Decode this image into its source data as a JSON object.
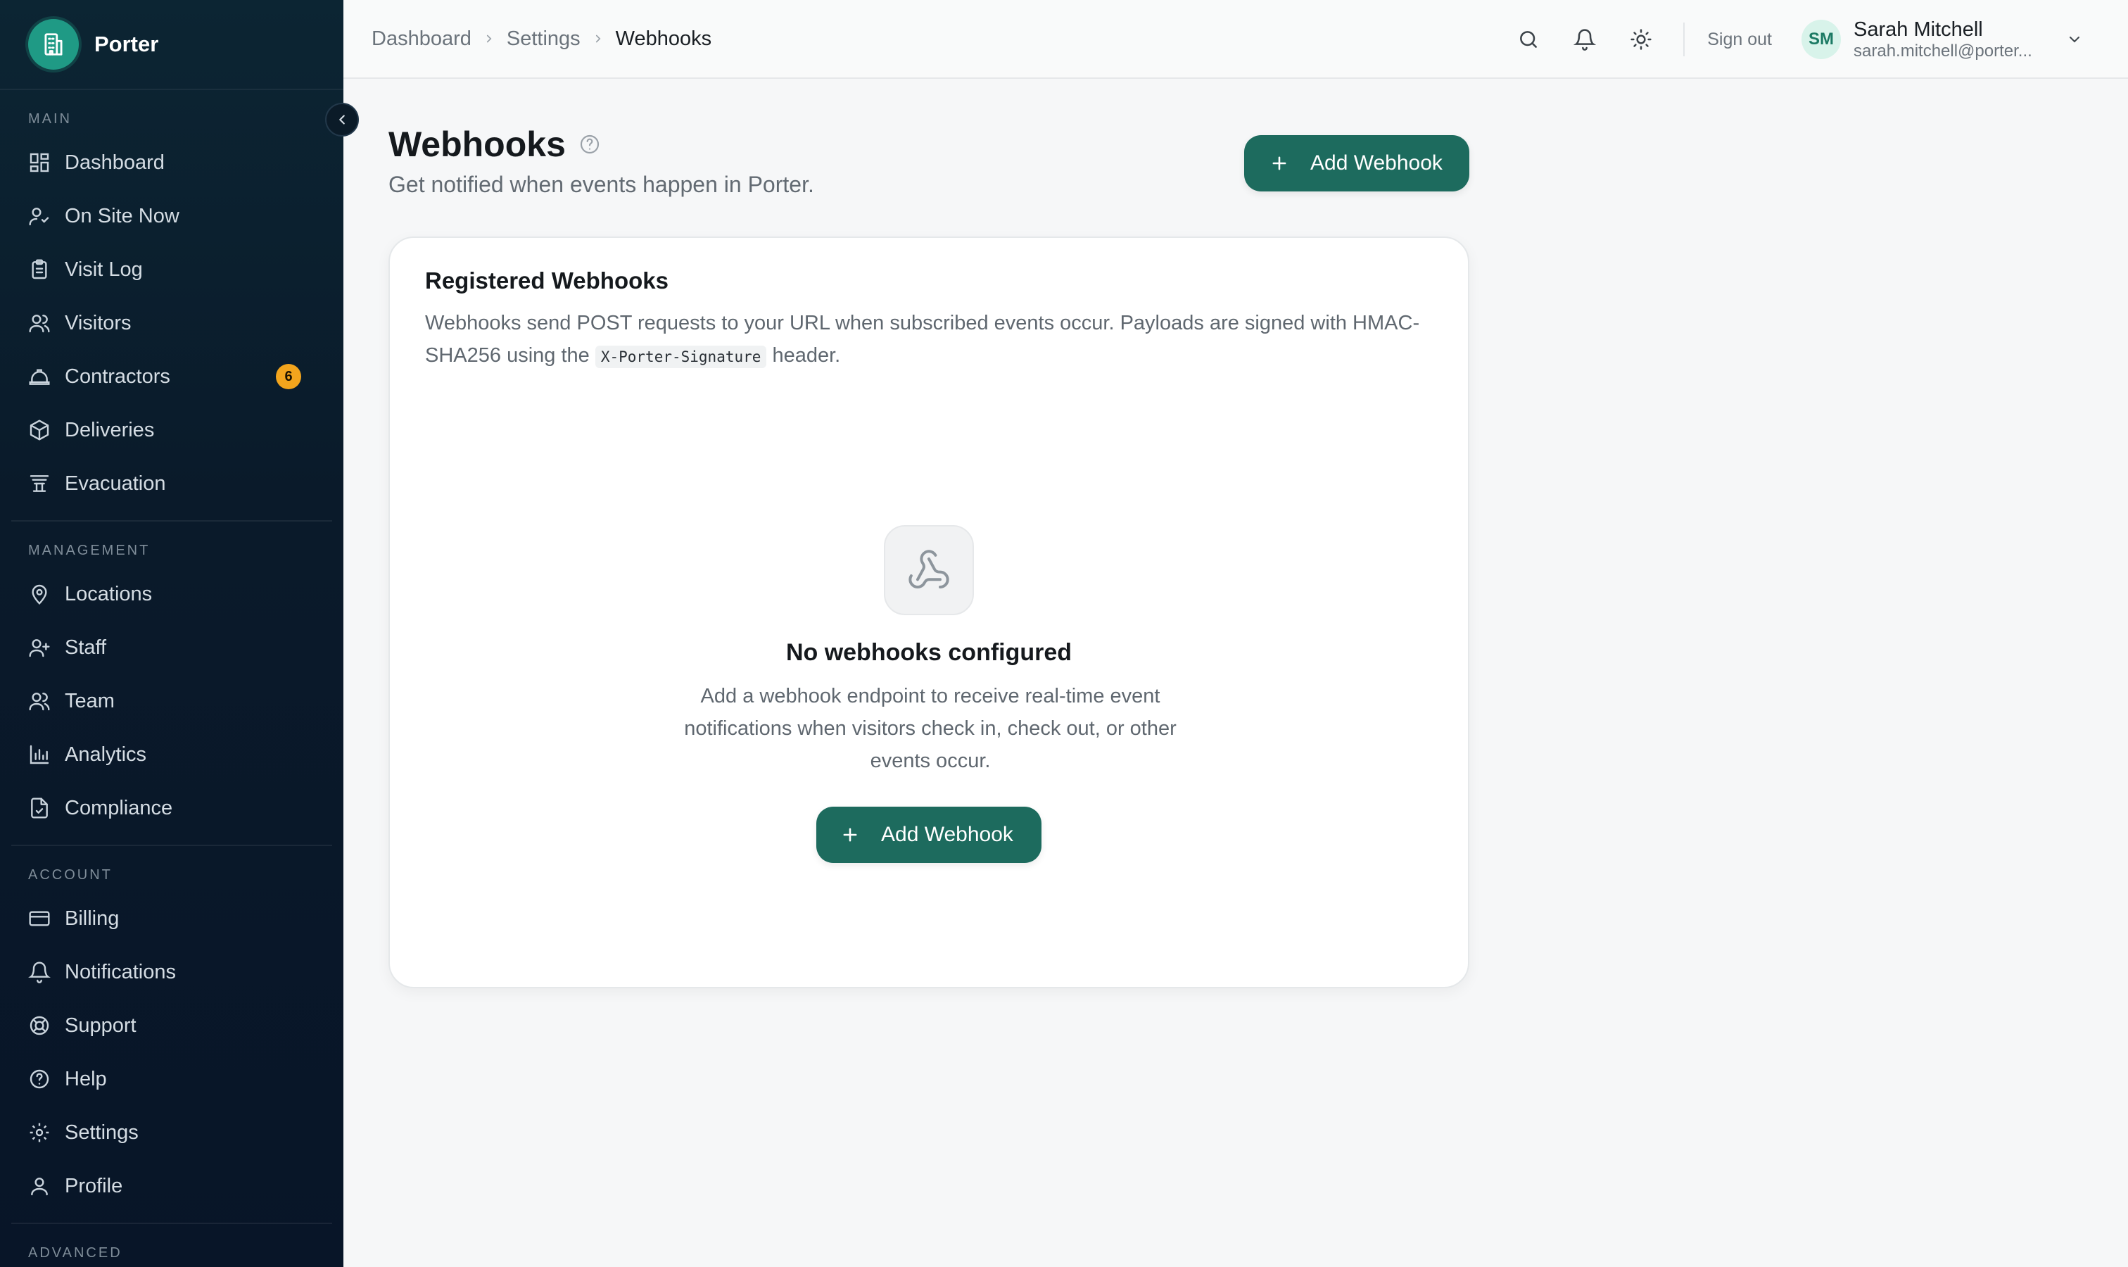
{
  "brand": {
    "name": "Porter",
    "logo_icon": "building-icon"
  },
  "sidebar": {
    "sections": [
      {
        "label": "MAIN",
        "items": [
          {
            "label": "Dashboard",
            "icon": "dashboard-icon"
          },
          {
            "label": "On Site Now",
            "icon": "user-check-icon"
          },
          {
            "label": "Visit Log",
            "icon": "clipboard-icon"
          },
          {
            "label": "Visitors",
            "icon": "users-icon"
          },
          {
            "label": "Contractors",
            "icon": "hard-hat-icon",
            "badge": "6"
          },
          {
            "label": "Deliveries",
            "icon": "package-icon"
          },
          {
            "label": "Evacuation",
            "icon": "evacuation-icon"
          }
        ]
      },
      {
        "label": "MANAGEMENT",
        "items": [
          {
            "label": "Locations",
            "icon": "map-pin-icon"
          },
          {
            "label": "Staff",
            "icon": "user-plus-icon"
          },
          {
            "label": "Team",
            "icon": "users-icon"
          },
          {
            "label": "Analytics",
            "icon": "bar-chart-icon"
          },
          {
            "label": "Compliance",
            "icon": "file-check-icon"
          }
        ]
      },
      {
        "label": "ACCOUNT",
        "items": [
          {
            "label": "Billing",
            "icon": "credit-card-icon"
          },
          {
            "label": "Notifications",
            "icon": "bell-icon"
          },
          {
            "label": "Support",
            "icon": "life-buoy-icon"
          },
          {
            "label": "Help",
            "icon": "help-circle-icon"
          },
          {
            "label": "Settings",
            "icon": "gear-icon"
          },
          {
            "label": "Profile",
            "icon": "user-icon"
          }
        ]
      },
      {
        "label": "ADVANCED",
        "items": []
      }
    ]
  },
  "breadcrumb": [
    "Dashboard",
    "Settings",
    "Webhooks"
  ],
  "topbar": {
    "sign_out": "Sign out",
    "user": {
      "initials": "SM",
      "name": "Sarah Mitchell",
      "email": "sarah.mitchell@porter..."
    }
  },
  "page": {
    "title": "Webhooks",
    "subtitle": "Get notified when events happen in Porter.",
    "add_button": "Add Webhook"
  },
  "card": {
    "title": "Registered Webhooks",
    "desc_before": "Webhooks send POST requests to your URL when subscribed events occur. Payloads are signed with HMAC-SHA256 using the",
    "desc_code": "X-Porter-Signature",
    "desc_after": "header.",
    "empty": {
      "icon": "webhook-icon",
      "title": "No webhooks configured",
      "description": "Add a webhook endpoint to receive real-time event notifications when visitors check in, check out, or other events occur.",
      "button": "Add Webhook"
    }
  },
  "colors": {
    "accent": "#1d6b5e",
    "badge": "#f3a51d",
    "sidebar_bg": "#0a1a2a"
  }
}
